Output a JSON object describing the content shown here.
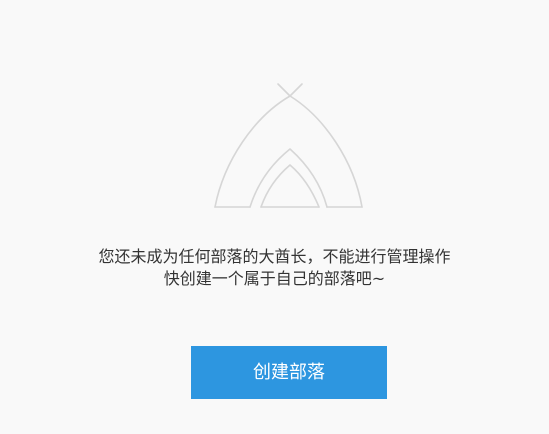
{
  "empty_state": {
    "illustration": {
      "icon": "tent-icon"
    },
    "message_line_1": "您还未成为任何部落的大酋长，不能进行管理操作",
    "message_line_2": "快创建一个属于自己的部落吧~",
    "button_label": "创建部落"
  },
  "colors": {
    "background": "#f9f9f9",
    "text": "#333333",
    "button_background": "#2d96e0",
    "button_text": "#ffffff",
    "icon_stroke": "#d6d6d6"
  }
}
